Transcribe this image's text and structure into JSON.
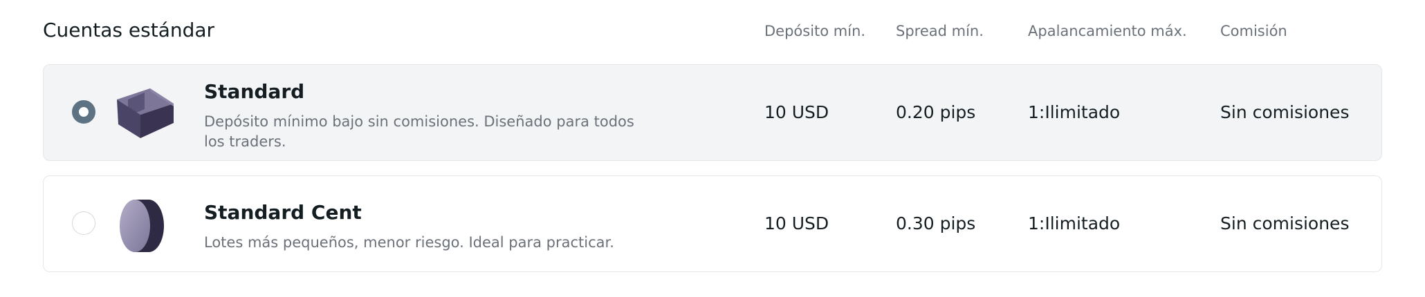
{
  "section": {
    "title": "Cuentas estándar"
  },
  "columns": {
    "min_deposit": "Depósito mín.",
    "min_spread": "Spread mín.",
    "max_leverage": "Apalancamiento máx.",
    "commission": "Comisión"
  },
  "accounts": [
    {
      "name": "Standard",
      "description": "Depósito mínimo bajo sin comisiones. Diseñado para todos los traders.",
      "min_deposit": "10 USD",
      "min_spread": "0.20 pips",
      "max_leverage": "1:Ilimitado",
      "commission": "Sin comisiones",
      "selected": true,
      "icon": "box-icon"
    },
    {
      "name": "Standard Cent",
      "description": "Lotes más pequeños, menor riesgo. Ideal para practicar.",
      "min_deposit": "10 USD",
      "min_spread": "0.30 pips",
      "max_leverage": "1:Ilimitado",
      "commission": "Sin comisiones",
      "selected": false,
      "icon": "coin-icon"
    }
  ],
  "colors": {
    "radio_checked": "#5d7384",
    "selected_card_bg": "#f3f4f6",
    "icon_dark": "#3f3a57",
    "icon_light": "#6b6488"
  }
}
